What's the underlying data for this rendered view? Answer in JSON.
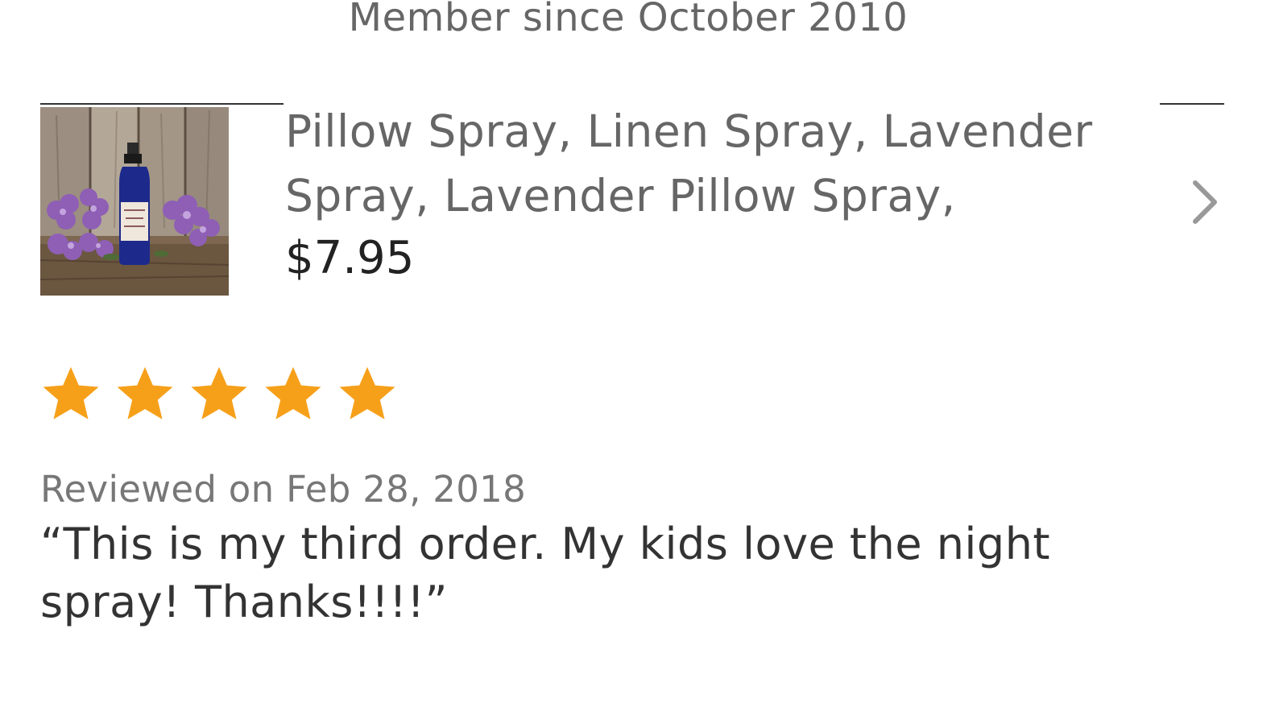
{
  "shop": {
    "member_since": "Member since October 2010"
  },
  "product": {
    "title": "Pillow Spray, Linen Spray, Lavender Spray, Lavender Pillow Spray,",
    "price": "$7.95",
    "image_alt": "lavender-spray-bottle-photo"
  },
  "review": {
    "rating": 5,
    "rating_max": 5,
    "star_color": "#f6a01a",
    "date": "Reviewed on Feb 28, 2018",
    "text": "“This is my third order. My kids love the night spray! Thanks!!!!”"
  },
  "icons": {
    "next": "chevron-right-icon",
    "star": "star-icon"
  }
}
